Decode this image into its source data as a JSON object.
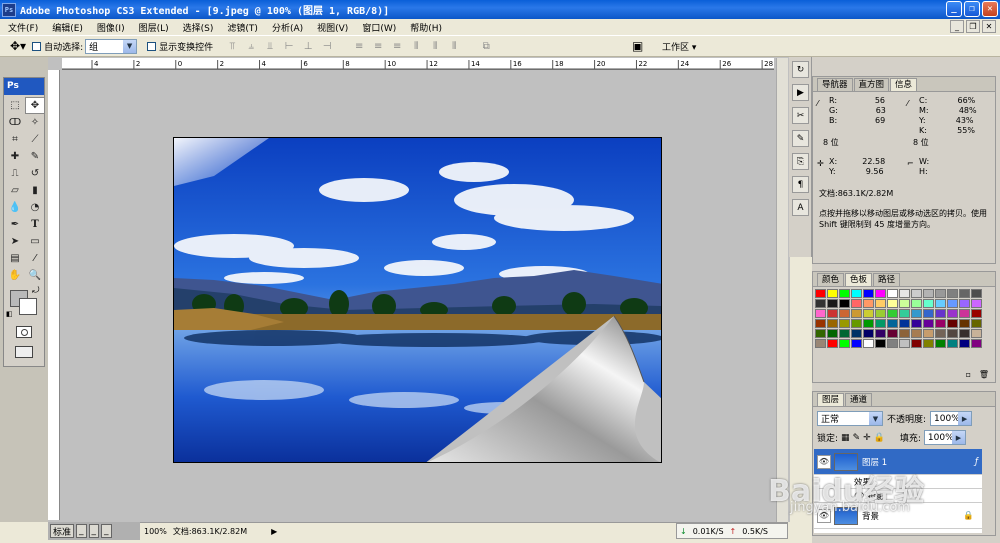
{
  "app": {
    "title": "Adobe Photoshop CS3 Extended - [9.jpeg @ 100% (图层 1, RGB/8)]",
    "ps_badge": "Ps"
  },
  "window_controls": {
    "minimize": "_",
    "restore": "❐",
    "close": "✕"
  },
  "menu": [
    "文件(F)",
    "编辑(E)",
    "图像(I)",
    "图层(L)",
    "选择(S)",
    "滤镜(T)",
    "分析(A)",
    "视图(V)",
    "窗口(W)",
    "帮助(H)"
  ],
  "options_bar": {
    "auto_select_label": "自动选择:",
    "auto_select_value": "组",
    "show_transform_label": "显示变换控件",
    "workspace_label": "工作区 ▾"
  },
  "toolbox": {
    "header": "Ps"
  },
  "ruler_top": [
    "4",
    "2",
    "0",
    "2",
    "4",
    "6",
    "8",
    "10",
    "12",
    "14",
    "16",
    "18",
    "20",
    "22",
    "24",
    "26",
    "28"
  ],
  "status": {
    "zoom": "100%",
    "doc_size": "文档:863.1K/2.82M",
    "taskbar_label": "标准"
  },
  "network": {
    "down": "0.01K/S",
    "up": "0.5K/S"
  },
  "info_panel": {
    "tabs": [
      "导航器",
      "直方图",
      "信息"
    ],
    "rgb": [
      {
        "k": "R:",
        "v": "56"
      },
      {
        "k": "G:",
        "v": "63"
      },
      {
        "k": "B:",
        "v": "69"
      }
    ],
    "cmyk": [
      {
        "k": "C:",
        "v": "66%"
      },
      {
        "k": "M:",
        "v": "48%"
      },
      {
        "k": "Y:",
        "v": "43%"
      },
      {
        "k": "K:",
        "v": "55%"
      }
    ],
    "bits_left": "8 位",
    "bits_right": "8 位",
    "x_label": "X:",
    "x_value": "22.58",
    "y_label": "Y:",
    "y_value": "9.56",
    "w_label": "W:",
    "h_label": "H:",
    "doc": "文档:863.1K/2.82M",
    "hint": "点按并拖移以移动图层或移动选区的拷贝。使用 Shift 键限制到 45 度增量方向。"
  },
  "swatches_panel": {
    "tabs": [
      "颜色",
      "色板",
      "路径"
    ]
  },
  "layers_panel": {
    "tabs": [
      "图层",
      "通道"
    ],
    "blend_mode": "正常",
    "opacity_label": "不透明度:",
    "opacity_value": "100%",
    "lock_label": "锁定:",
    "fill_label": "填充:",
    "fill_value": "100%",
    "layers": [
      {
        "name": "图层 1",
        "active": true
      },
      {
        "name": "效果",
        "active": false
      },
      {
        "name": "投影",
        "active": false
      },
      {
        "name": "背景",
        "active": false
      }
    ]
  },
  "watermark": {
    "logo": "Baidu经验",
    "url": "jingyan.baidu.com"
  },
  "colors": {
    "title_bar": "#0a5fd8",
    "selection": "#316ac5",
    "sky": "#1e5fcf"
  }
}
